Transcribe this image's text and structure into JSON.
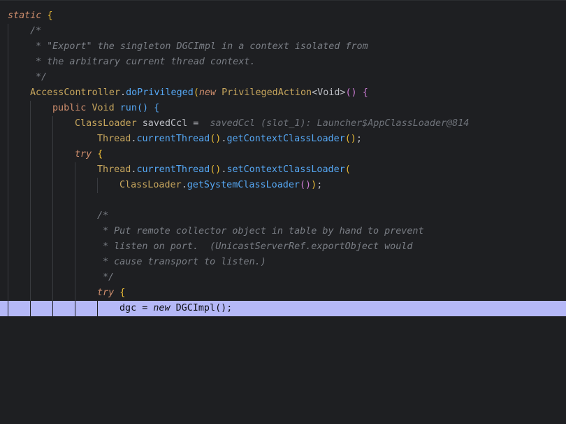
{
  "editor": {
    "lines": [
      {
        "k": "static",
        "b": "{"
      },
      {
        "t": "/*"
      },
      {
        "t": "* \"Export\" the singleton DGCImpl in a context isolated from"
      },
      {
        "t": "* the arbitrary current thread context."
      },
      {
        "t": "*/"
      },
      {
        "ac": "AccessController",
        "dot": ".",
        "m": "doPrivileged",
        "op": "(",
        "nw": "new",
        "pa": "PrivilegedAction",
        "gt": "<Void>",
        "pp": "()",
        "br": "{"
      },
      {
        "k": "public",
        "ty": "Void",
        "m": "run",
        "pp": "()",
        "br": "{"
      },
      {
        "ty": "ClassLoader",
        "v": "savedCcl =",
        "hint": "savedCcl (slot_1): Launcher$AppClassLoader@814"
      },
      {
        "ty": "Thread",
        "dot": ".",
        "m": "currentThread",
        "pp": "()",
        "dot2": ".",
        "m2": "getContextClassLoader",
        "pp2": "()",
        "end": ";"
      },
      {
        "k": "try",
        "br": "{"
      },
      {
        "ty": "Thread",
        "dot": ".",
        "m": "currentThread",
        "pp": "()",
        "dot2": ".",
        "m2": "setContextClassLoader",
        "op": "("
      },
      {
        "ty": "ClassLoader",
        "dot": ".",
        "m": "getSystemClassLoader",
        "pp": "()",
        "cp": ")",
        "end": ";"
      },
      {
        "t": ""
      },
      {
        "t": "/*"
      },
      {
        "t": "* Put remote collector object in table by hand to prevent"
      },
      {
        "t": "* listen on port.  (UnicastServerRef.exportObject would"
      },
      {
        "t": "* cause transport to listen.)"
      },
      {
        "t": "*/"
      },
      {
        "k": "try",
        "br": "{"
      },
      {
        "v": "dgc = ",
        "k": "new",
        "ty": "DGCImpl",
        "pp": "()",
        "end": ";"
      }
    ]
  }
}
